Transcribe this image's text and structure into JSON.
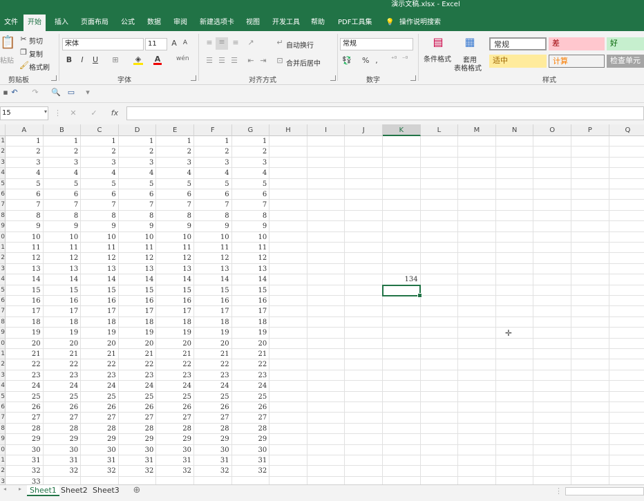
{
  "title": "演示文稿.xlsx  -  Excel",
  "tabs": [
    {
      "label": "文件",
      "active": false
    },
    {
      "label": "开始",
      "active": true
    },
    {
      "label": "插入",
      "active": false
    },
    {
      "label": "页面布局",
      "active": false
    },
    {
      "label": "公式",
      "active": false
    },
    {
      "label": "数据",
      "active": false
    },
    {
      "label": "审阅",
      "active": false
    },
    {
      "label": "新建选项卡",
      "active": false
    },
    {
      "label": "视图",
      "active": false
    },
    {
      "label": "开发工具",
      "active": false
    },
    {
      "label": "帮助",
      "active": false
    },
    {
      "label": "PDF工具集",
      "active": false
    }
  ],
  "tell_me": "操作说明搜索",
  "ribbon": {
    "clipboard": {
      "paste": "粘贴",
      "cut": "剪切",
      "copy": "复制",
      "format_painter": "格式刷",
      "label": "剪贴板"
    },
    "font": {
      "name": "宋体",
      "size": "11",
      "bold": "B",
      "italic": "I",
      "underline": "U",
      "label": "字体",
      "grow": "A",
      "shrink": "A",
      "font_color": "A",
      "wen": "wén"
    },
    "alignment": {
      "wrap": "自动换行",
      "merge": "合并后居中",
      "label": "对齐方式"
    },
    "number": {
      "format": "常规",
      "percent": "%",
      "comma": ",",
      "label": "数字"
    },
    "styles": {
      "conditional": "条件格式",
      "table_line1": "套用",
      "table_line2": "表格格式",
      "label": "样式",
      "cells": [
        {
          "text": "常规",
          "bg": "#ffffff",
          "fg": "#333333"
        },
        {
          "text": "差",
          "bg": "#ffc7ce",
          "fg": "#9c0006"
        },
        {
          "text": "好",
          "bg": "#c6efce",
          "fg": "#006100"
        },
        {
          "text": "适中",
          "bg": "#ffeb9c",
          "fg": "#9c6500"
        },
        {
          "text": "计算",
          "bg": "#f2f2f2",
          "fg": "#fa7d00"
        },
        {
          "text": "检查单元",
          "bg": "#a5a5a5",
          "fg": "#ffffff"
        }
      ]
    }
  },
  "formula_bar": {
    "name_box": "15",
    "cancel": "✕",
    "enter": "✓",
    "fx": "fx",
    "value": ""
  },
  "grid": {
    "columns": [
      "A",
      "B",
      "C",
      "D",
      "E",
      "F",
      "G",
      "H",
      "I",
      "J",
      "K",
      "L",
      "M",
      "N",
      "O",
      "P",
      "Q"
    ],
    "selected_column": "K",
    "filled_columns": 7,
    "rows": [
      "1",
      "2",
      "3",
      "4",
      "5",
      "6",
      "7",
      "8",
      "9",
      "10",
      "11",
      "12",
      "13",
      "14",
      "15",
      "16",
      "17",
      "18",
      "19",
      "20",
      "21",
      "22",
      "23",
      "24",
      "25",
      "26",
      "27",
      "28",
      "29",
      "30",
      "31",
      "32",
      "33"
    ],
    "row_header_visible": [
      "1",
      "2",
      "3",
      "4",
      "5",
      "6",
      "7",
      "8",
      "9",
      "0",
      "1",
      "2",
      "3",
      "4",
      "5",
      "6",
      "7",
      "8",
      "9",
      "0",
      "1",
      "2",
      "3",
      "4",
      "5",
      "6",
      "7",
      "8",
      "9",
      "0",
      "1",
      "2",
      "3"
    ],
    "extra_cell": {
      "column": "K",
      "row": 14,
      "value": "134"
    },
    "selected_cell": {
      "column": "K",
      "row": 15
    }
  },
  "sheets": [
    {
      "label": "Sheet1",
      "active": true
    },
    {
      "label": "Sheet2",
      "active": false
    },
    {
      "label": "Sheet3",
      "active": false
    }
  ],
  "add_sheet": "⊕"
}
